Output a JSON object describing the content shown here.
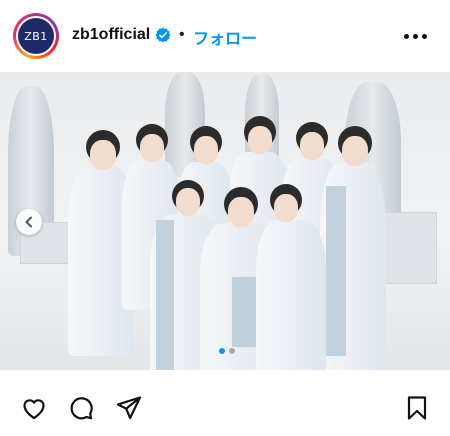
{
  "header": {
    "avatar_text": "ZB1",
    "username": "zb1official",
    "separator": "•",
    "follow_label": "フォロー"
  },
  "icons": {
    "verified": "verified-badge-icon",
    "more": "more-horizontal-icon",
    "prev": "chevron-left-icon",
    "like": "heart-icon",
    "comment": "comment-icon",
    "share": "send-icon",
    "save": "bookmark-icon"
  },
  "carousel": {
    "total": 2,
    "active": 1
  },
  "colors": {
    "follow": "#0095f6",
    "verified": "#0095f6",
    "dot_active": "#0095f6",
    "dot_inactive": "#a8a8a8"
  }
}
